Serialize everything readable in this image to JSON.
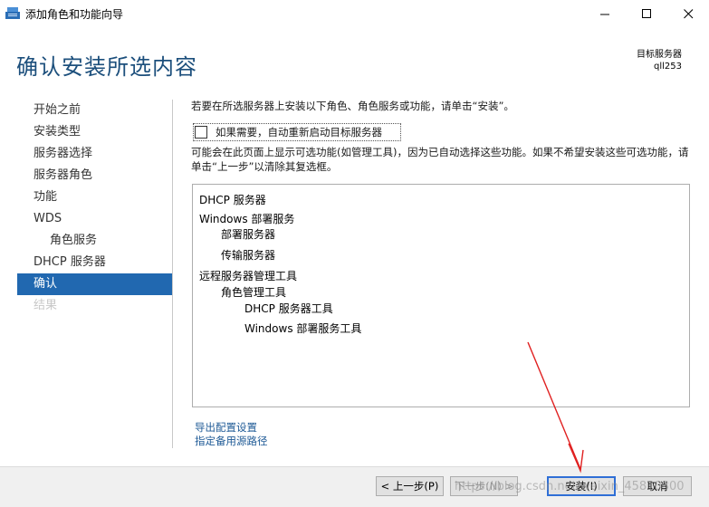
{
  "window": {
    "title": "添加角色和功能向导",
    "icon": "server-manager-icon",
    "minimize_icon": "minimize-icon",
    "maximize_icon": "maximize-icon",
    "close_icon": "close-icon"
  },
  "header": {
    "page_title": "确认安装所选内容",
    "target_label": "目标服务器",
    "target_name": "qll253"
  },
  "nav": {
    "items": [
      {
        "label": "开始之前"
      },
      {
        "label": "安装类型"
      },
      {
        "label": "服务器选择"
      },
      {
        "label": "服务器角色"
      },
      {
        "label": "功能"
      },
      {
        "label": "WDS"
      },
      {
        "label": "角色服务"
      },
      {
        "label": "DHCP 服务器"
      },
      {
        "label": "确认"
      },
      {
        "label": "结果"
      }
    ]
  },
  "main": {
    "intro": "若要在所选服务器上安装以下角色、角色服务或功能，请单击“安装”。",
    "restart_label": "如果需要，自动重新启动目标服务器",
    "note": "可能会在此页面上显示可选功能(如管理工具)，因为已自动选择这些功能。如果不希望安装这些可选功能，请单击“上一步”以清除其复选框。",
    "list": [
      "DHCP 服务器",
      "Windows 部署服务",
      "部署服务器",
      "传输服务器",
      "远程服务器管理工具",
      "角色管理工具",
      "DHCP 服务器工具",
      "Windows 部署服务工具"
    ],
    "links": {
      "export": "导出配置设置",
      "alt_source": "指定备用源路径"
    }
  },
  "footer": {
    "prev": "< 上一步(P)",
    "next": "下一步(N) >",
    "install": "安装(I)",
    "cancel": "取消"
  },
  "watermark": "https://blog.csdn.net/weixin_45810300",
  "colors": {
    "accent": "#2168b0",
    "title": "#1c4f7c",
    "link": "#1e5a96",
    "arrow": "#e02020"
  }
}
